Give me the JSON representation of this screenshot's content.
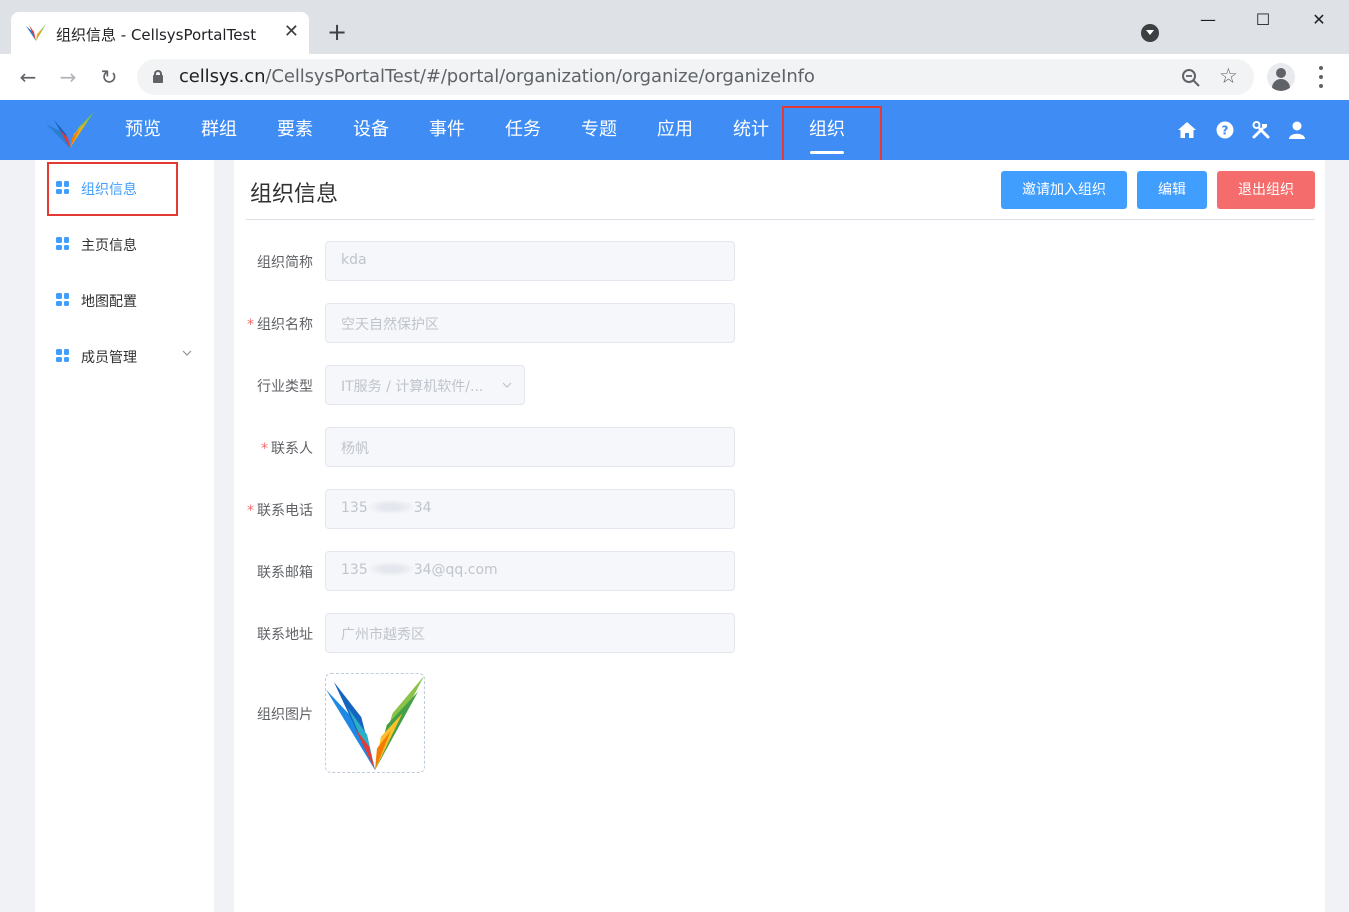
{
  "browser": {
    "tab_title": "组织信息 - CellsysPortalTest",
    "url_host": "cellsys.cn",
    "url_rest": "/CellsysPortalTest/#/portal/organization/organize/organizeInfo"
  },
  "header": {
    "nav": [
      "预览",
      "群组",
      "要素",
      "设备",
      "事件",
      "任务",
      "专题",
      "应用",
      "统计",
      "组织"
    ],
    "active_nav": "组织"
  },
  "sidebar": {
    "items": [
      {
        "label": "组织信息",
        "active": true
      },
      {
        "label": "主页信息",
        "active": false
      },
      {
        "label": "地图配置",
        "active": false
      },
      {
        "label": "成员管理",
        "active": false,
        "expandable": true
      }
    ]
  },
  "main": {
    "title": "组织信息",
    "buttons": {
      "invite": "邀请加入组织",
      "edit": "编辑",
      "leave": "退出组织"
    },
    "form": {
      "short_name": {
        "label": "组织简称",
        "value": "kda",
        "required": false
      },
      "full_name": {
        "label": "组织名称",
        "value": "空天自然保护区",
        "required": true
      },
      "industry": {
        "label": "行业类型",
        "value": "IT服务 / 计算机软件/...",
        "required": false
      },
      "contact": {
        "label": "联系人",
        "value": "杨帆",
        "required": true
      },
      "phone": {
        "label": "联系电话",
        "value_prefix": "135",
        "value_suffix": "34",
        "required": true
      },
      "email": {
        "label": "联系邮箱",
        "value_prefix": "135",
        "value_suffix": "34@qq.com",
        "required": false
      },
      "address": {
        "label": "联系地址",
        "value": "广州市越秀区",
        "required": false
      },
      "image": {
        "label": "组织图片"
      }
    }
  },
  "colors": {
    "header_bg": "#3f8cf5",
    "primary": "#409eff",
    "danger": "#f56c6c",
    "highlight_box": "#e53935"
  }
}
